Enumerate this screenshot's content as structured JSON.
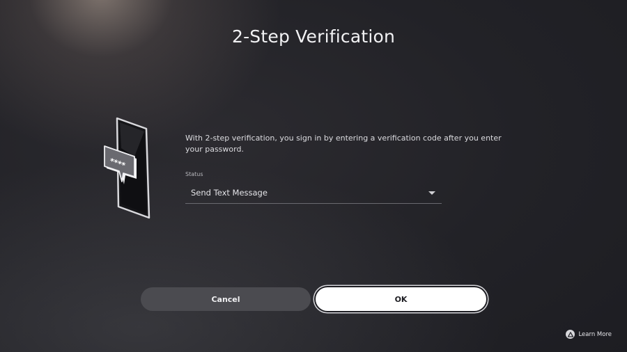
{
  "page": {
    "title": "2-Step Verification",
    "description": "With 2-step verification, you sign in by entering a verification code after you enter your password."
  },
  "status_field": {
    "label": "Status",
    "value": "Send Text Message"
  },
  "buttons": {
    "cancel": "Cancel",
    "ok": "OK"
  },
  "footer": {
    "learn_more": "Learn More",
    "learn_more_icon": "triangle-button-icon"
  },
  "illustration": {
    "icon": "phone-verification-code-icon",
    "code_text": "****"
  },
  "colors": {
    "background": "#222227",
    "ok_button": "#ffffff",
    "cancel_button": "#4b4b50"
  }
}
